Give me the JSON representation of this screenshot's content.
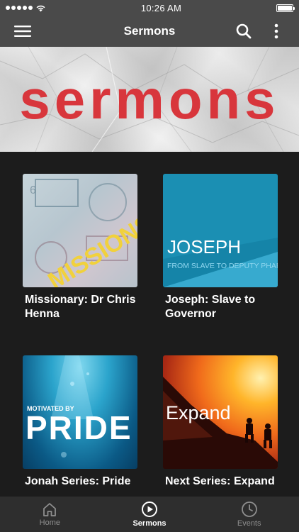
{
  "status_bar": {
    "time": "10:26 AM",
    "signal_icon": "signal-dots-icon",
    "wifi_icon": "wifi-icon",
    "battery_icon": "battery-icon"
  },
  "nav_bar": {
    "title": "Sermons",
    "menu_icon": "hamburger-menu-icon",
    "search_icon": "search-icon",
    "more_icon": "more-vertical-icon"
  },
  "hero": {
    "title": "sermons",
    "title_color": "#d8363c"
  },
  "series": [
    {
      "title": "Missionary: Dr Chris Henna",
      "art_text": "MISSIONS",
      "art_sub": ""
    },
    {
      "title": "Joseph: Slave to Governor",
      "art_text": "JOSEPH",
      "art_sub": "FROM SLAVE TO DEPUTY PHARAOH"
    },
    {
      "title": "Jonah Series: Pride",
      "art_text": "PRIDE",
      "art_sub": "MOTIVATED BY"
    },
    {
      "title": "Next Series: Expand",
      "art_text": "Expand",
      "art_sub": ""
    }
  ],
  "tab_bar": {
    "tabs": [
      {
        "label": "Home",
        "icon": "home-icon",
        "active": false
      },
      {
        "label": "Sermons",
        "icon": "play-circle-icon",
        "active": true
      },
      {
        "label": "Events",
        "icon": "clock-icon",
        "active": false
      }
    ]
  },
  "colors": {
    "bars": "#4a4a4a",
    "background": "#1c1c1c",
    "tab_bar": "#2e2e2e",
    "accent_red": "#d8363c"
  }
}
